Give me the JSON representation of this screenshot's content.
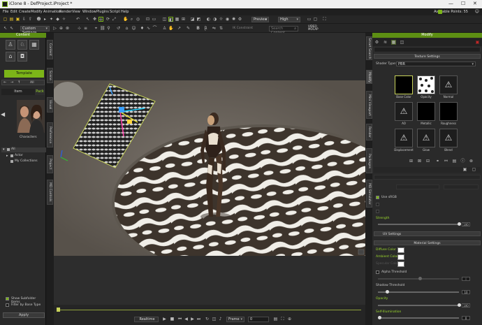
{
  "window": {
    "title": "iClone 8 - DefProject.iProject *",
    "minimize": "—",
    "maximize": "☐",
    "close": "✕"
  },
  "menu": [
    "File",
    "Edit",
    "Create",
    "Modify",
    "Animation",
    "Render",
    "View",
    "Window",
    "Plugins",
    "Script",
    "Help"
  ],
  "account": {
    "points": "Available Points: 55"
  },
  "toolbar": {
    "custom_settings": "Custom Settings",
    "preview": "Preview",
    "quality": "High",
    "ik_label": "IK Constraint",
    "search_placeholder": "Search Content",
    "video_mocap": "VIDEO MOCAP"
  },
  "content": {
    "header": "Content",
    "template_tab": "Template",
    "breadcrumb_all": "All",
    "item_tab": "Item",
    "pack_tab": "Pack",
    "folder_label": "Characters",
    "tree": [
      "All",
      "Actor",
      "My Collections"
    ],
    "show_subfolder": "Show Subfolder Items",
    "filter_base": "Filter by Base Type",
    "apply": "Apply"
  },
  "left_tabs": [
    "Content",
    "Scene",
    "Visual",
    "Preference",
    "Project",
    "MD Controls"
  ],
  "right_tabs": [
    "Smart Search",
    "Modify",
    "Mini Viewport",
    "Render",
    "Packages",
    "MD Simulator"
  ],
  "modify": {
    "header": "Modify",
    "texture_settings": "Texture Settings",
    "shader_label": "Shader Type:",
    "shader_value": "PBR",
    "textures": [
      "Base Color",
      "Opacity",
      "Normal",
      "AO",
      "Metallic",
      "Roughness",
      "Displacement",
      "Glow",
      "Blend"
    ],
    "srgb": "Use sRGB",
    "strength": "Strength",
    "strength_value": "100",
    "uv_settings": "UV Settings",
    "material_settings": "Material Settings",
    "diffuse": "Diffuse Color",
    "ambient": "Ambient Color",
    "specular": "Specular Color",
    "alpha_threshold": "Alpha Threshold",
    "alpha_value": "0",
    "shadow_threshold": "Shadow Threshold",
    "shadow_value": "10",
    "opacity": "Opacity",
    "opacity_value": "100",
    "self_illum": "Self-Illumination",
    "self_illum_value": "0"
  },
  "playback": {
    "mode": "Realtime",
    "frame_label": "Frame",
    "frame_value": "0"
  },
  "colors": {
    "accent": "#7cb518",
    "panel": "#2a2a2a"
  }
}
